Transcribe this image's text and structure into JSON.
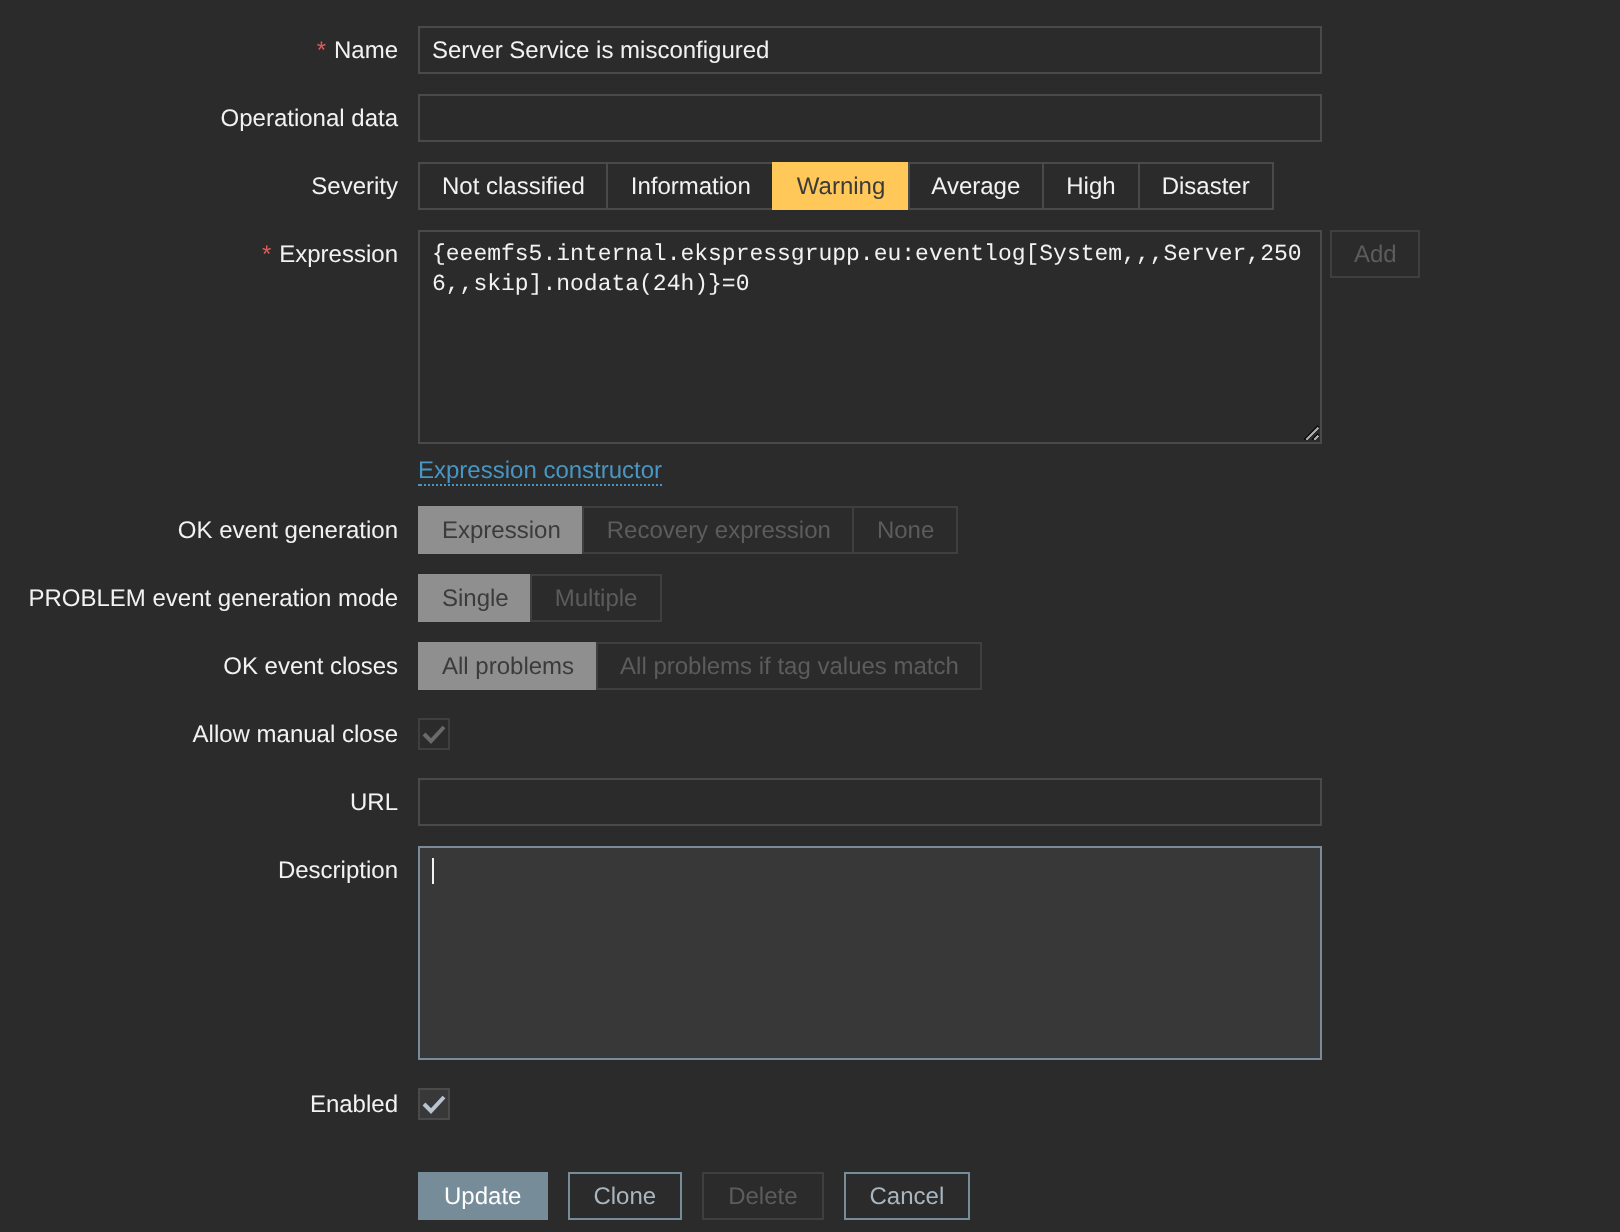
{
  "rows": [
    {
      "kind": "text",
      "label": "Name",
      "required_mark": "*",
      "value": "Server Service is misconfigured"
    },
    {
      "kind": "text",
      "label": "Operational data"
    },
    {
      "kind": "segmented",
      "label": "Severity",
      "disabled": false,
      "options": [
        {
          "label": "Not classified",
          "selected": false
        },
        {
          "label": "Information",
          "selected": false
        },
        {
          "label": "Warning",
          "selected": true,
          "color": "#ffc859"
        },
        {
          "label": "Average",
          "selected": false
        },
        {
          "label": "High",
          "selected": false
        },
        {
          "label": "Disaster",
          "selected": false
        }
      ]
    },
    {
      "kind": "expression",
      "label": "Expression",
      "required_mark": "*",
      "value": "{eeemfs5.internal.ekspressgrupp.eu:eventlog[System,,,Server,2506,,skip].nodata(24h)}=0",
      "button": "Add",
      "link": "Expression constructor"
    },
    {
      "kind": "segmented",
      "label": "OK event generation",
      "disabled": true,
      "options": [
        {
          "label": "Expression",
          "selected": true
        },
        {
          "label": "Recovery expression",
          "selected": false
        },
        {
          "label": "None",
          "selected": false
        }
      ]
    },
    {
      "kind": "segmented",
      "label": "PROBLEM event generation mode",
      "disabled": true,
      "options": [
        {
          "label": "Single",
          "selected": true
        },
        {
          "label": "Multiple",
          "selected": false
        }
      ]
    },
    {
      "kind": "segmented",
      "label": "OK event closes",
      "disabled": true,
      "options": [
        {
          "label": "All problems",
          "selected": true
        },
        {
          "label": "All problems if tag values match",
          "selected": false
        }
      ]
    },
    {
      "kind": "checkbox",
      "label": "Allow manual close",
      "checked": true,
      "disabled": true
    },
    {
      "kind": "text",
      "label": "URL"
    },
    {
      "kind": "textarea",
      "label": "Description",
      "focused": true
    },
    {
      "kind": "checkbox",
      "label": "Enabled",
      "checked": true,
      "disabled": false
    }
  ],
  "buttons": [
    {
      "label": "Update",
      "kind": "primary",
      "disabled": false
    },
    {
      "label": "Clone",
      "kind": "secondary",
      "disabled": false
    },
    {
      "label": "Delete",
      "kind": "secondary",
      "disabled": true
    },
    {
      "label": "Cancel",
      "kind": "secondary",
      "disabled": false
    }
  ]
}
